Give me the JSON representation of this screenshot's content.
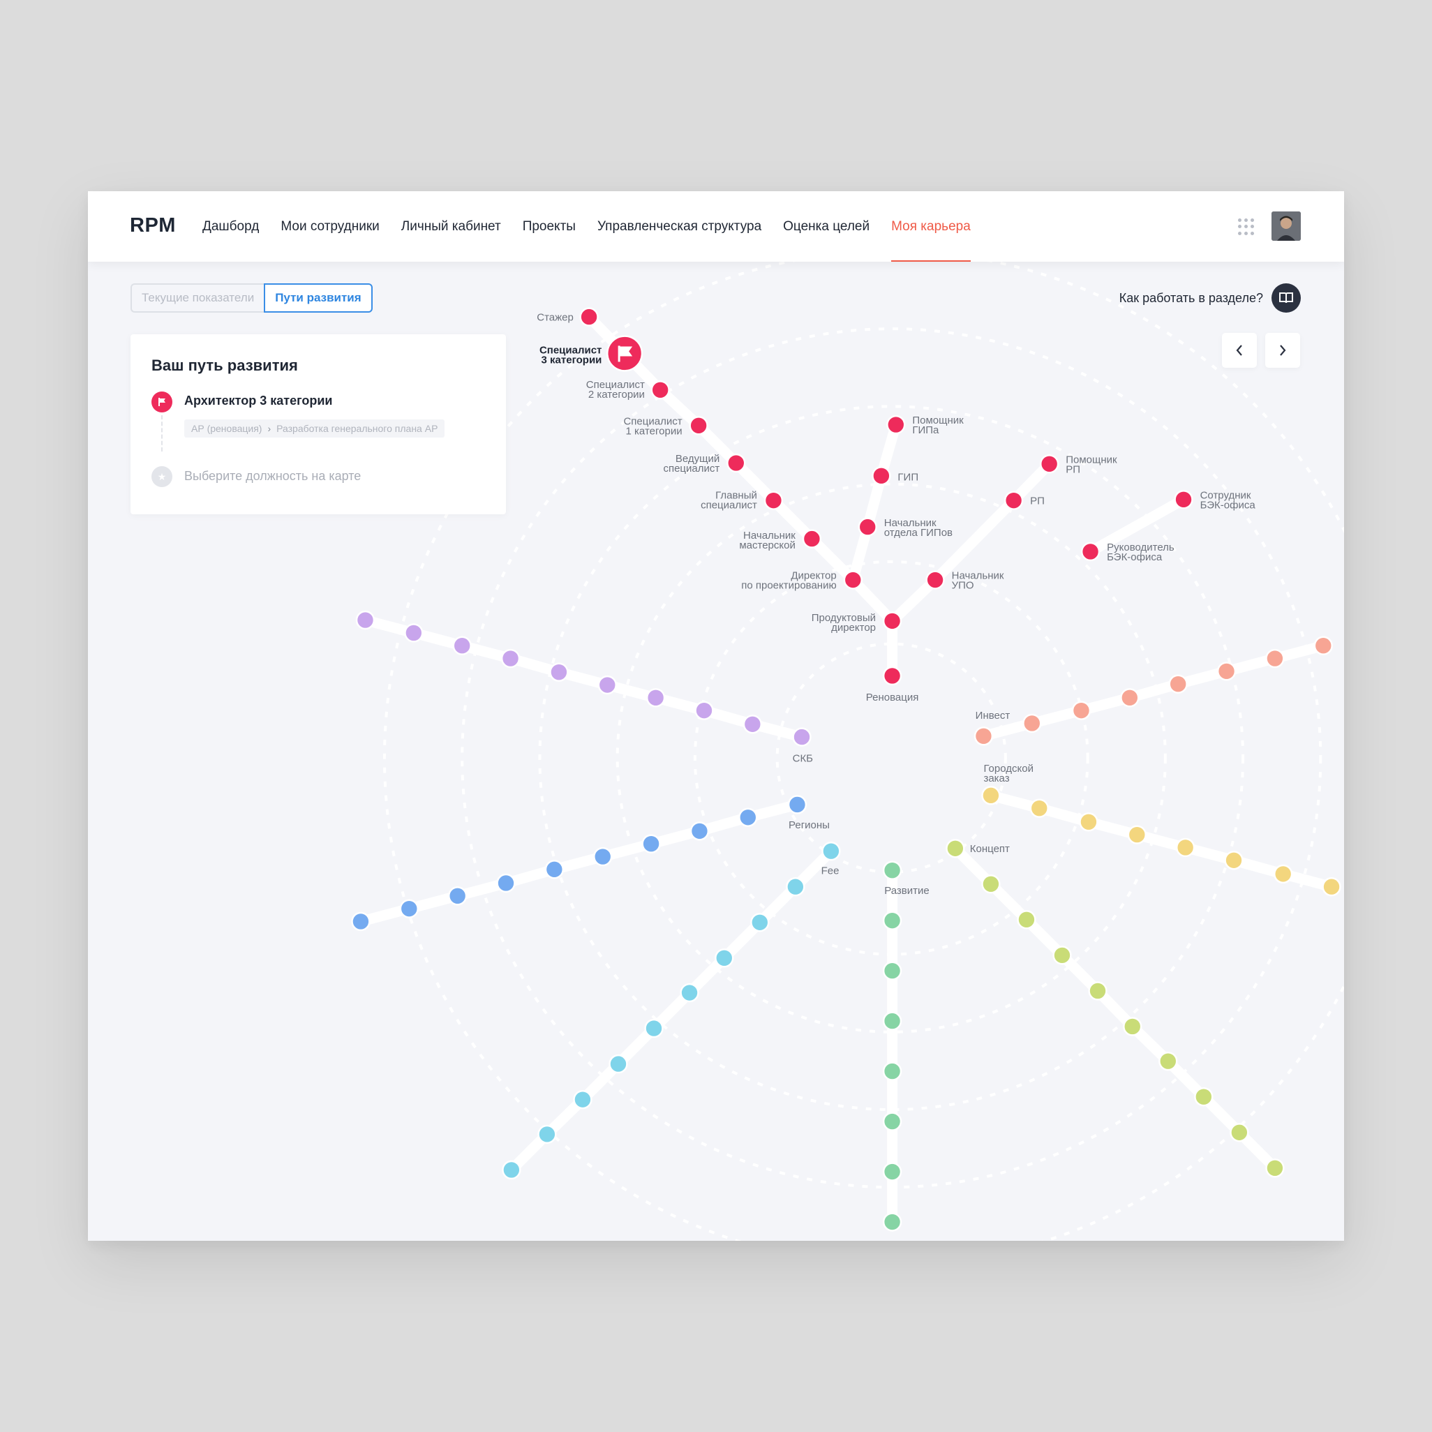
{
  "logo": "RPM",
  "nav": [
    "Дашборд",
    "Мои сотрудники",
    "Личный кабинет",
    "Проекты",
    "Управленческая структура",
    "Оценка целей",
    "Моя карьера"
  ],
  "tabs": {
    "current": "Текущие показатели",
    "paths": "Пути развития"
  },
  "help": {
    "label": "Как работать в разделе?"
  },
  "card": {
    "title": "Ваш путь развития",
    "selected_position": "Архитектор 3 категории",
    "breadcrumb": [
      "АР (реновация)",
      "Разработка генерального плана АР"
    ],
    "choose_hint": "Выберите должность на карте"
  },
  "colors": {
    "accent": "#ef5a47",
    "link": "#2f86e0",
    "branches": {
      "renovation": "#ee2b5b",
      "skb": "#c8a5ec",
      "regions": "#74aaf0",
      "fee": "#7fd4ea",
      "development": "#86d4a4",
      "concept": "#c9dc77",
      "city": "#f3d67e",
      "invest": "#f7a594"
    }
  },
  "map": {
    "nodes": [
      {
        "label": "Стажер"
      },
      {
        "label": "Специалист 3 категории"
      },
      {
        "label": "Специалист 2 категории"
      },
      {
        "label": "Специалист 1 категории"
      },
      {
        "label": "Ведущий специалист"
      },
      {
        "label": "Главный специалист"
      },
      {
        "label": "Начальник мастерской"
      },
      {
        "label": "Директор по проектированию"
      },
      {
        "label": "Помощник ГИПа"
      },
      {
        "label": "ГИП"
      },
      {
        "label": "Начальник отдела ГИПов"
      },
      {
        "label": "Помощник РП"
      },
      {
        "label": "РП"
      },
      {
        "label": "Начальник УПО"
      },
      {
        "label": "Сотрудник БЭК-офиса"
      },
      {
        "label": "Руководитель БЭК-офиса"
      },
      {
        "label": "Продуктовый директор"
      },
      {
        "label": "Реновация"
      }
    ],
    "branch_labels": [
      "СКБ",
      "Регионы",
      "Fee",
      "Развитие",
      "Концепт",
      "Городской заказ",
      "Инвест"
    ]
  }
}
